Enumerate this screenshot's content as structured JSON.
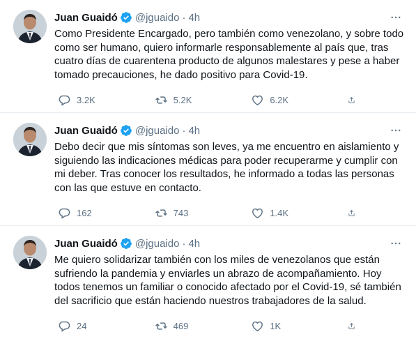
{
  "author": {
    "name": "Juan Guaidó",
    "handle": "@jguaido",
    "separator": "·"
  },
  "colors": {
    "verified": "#1da1f2",
    "muted": "#5b7083",
    "text": "#0f1419",
    "divider": "#e6ecf0"
  },
  "icons": [
    "verified-badge-icon",
    "more-options-icon",
    "reply-icon",
    "retweet-icon",
    "like-icon",
    "share-icon"
  ],
  "tweets": [
    {
      "time": "4h",
      "text": "Como Presidente Encargado, pero también como venezolano, y sobre todo como ser humano, quiero informarle responsablemente al país que, tras cuatro días de cuarentena producto de algunos malestares y pese a haber tomado precauciones, he dado positivo para Covid-19.",
      "replies": "3.2K",
      "retweets": "5.2K",
      "likes": "6.2K"
    },
    {
      "time": "4h",
      "text": "Debo decir que mis síntomas son leves, ya me encuentro en aislamiento y siguiendo las indicaciones médicas para poder recuperarme y cumplir con mi deber. Tras conocer los resultados, he informado a todas las personas con las que estuve en contacto.",
      "replies": "162",
      "retweets": "743",
      "likes": "1.4K"
    },
    {
      "time": "4h",
      "text": "Me quiero solidarizar también con los miles de venezolanos que están sufriendo la pandemia y enviarles un abrazo de acompañamiento. Hoy todos tenemos un familiar o conocido afectado por el Covid-19, sé también del sacrificio que están haciendo nuestros trabajadores de la salud.",
      "replies": "24",
      "retweets": "469",
      "likes": "1K"
    }
  ]
}
